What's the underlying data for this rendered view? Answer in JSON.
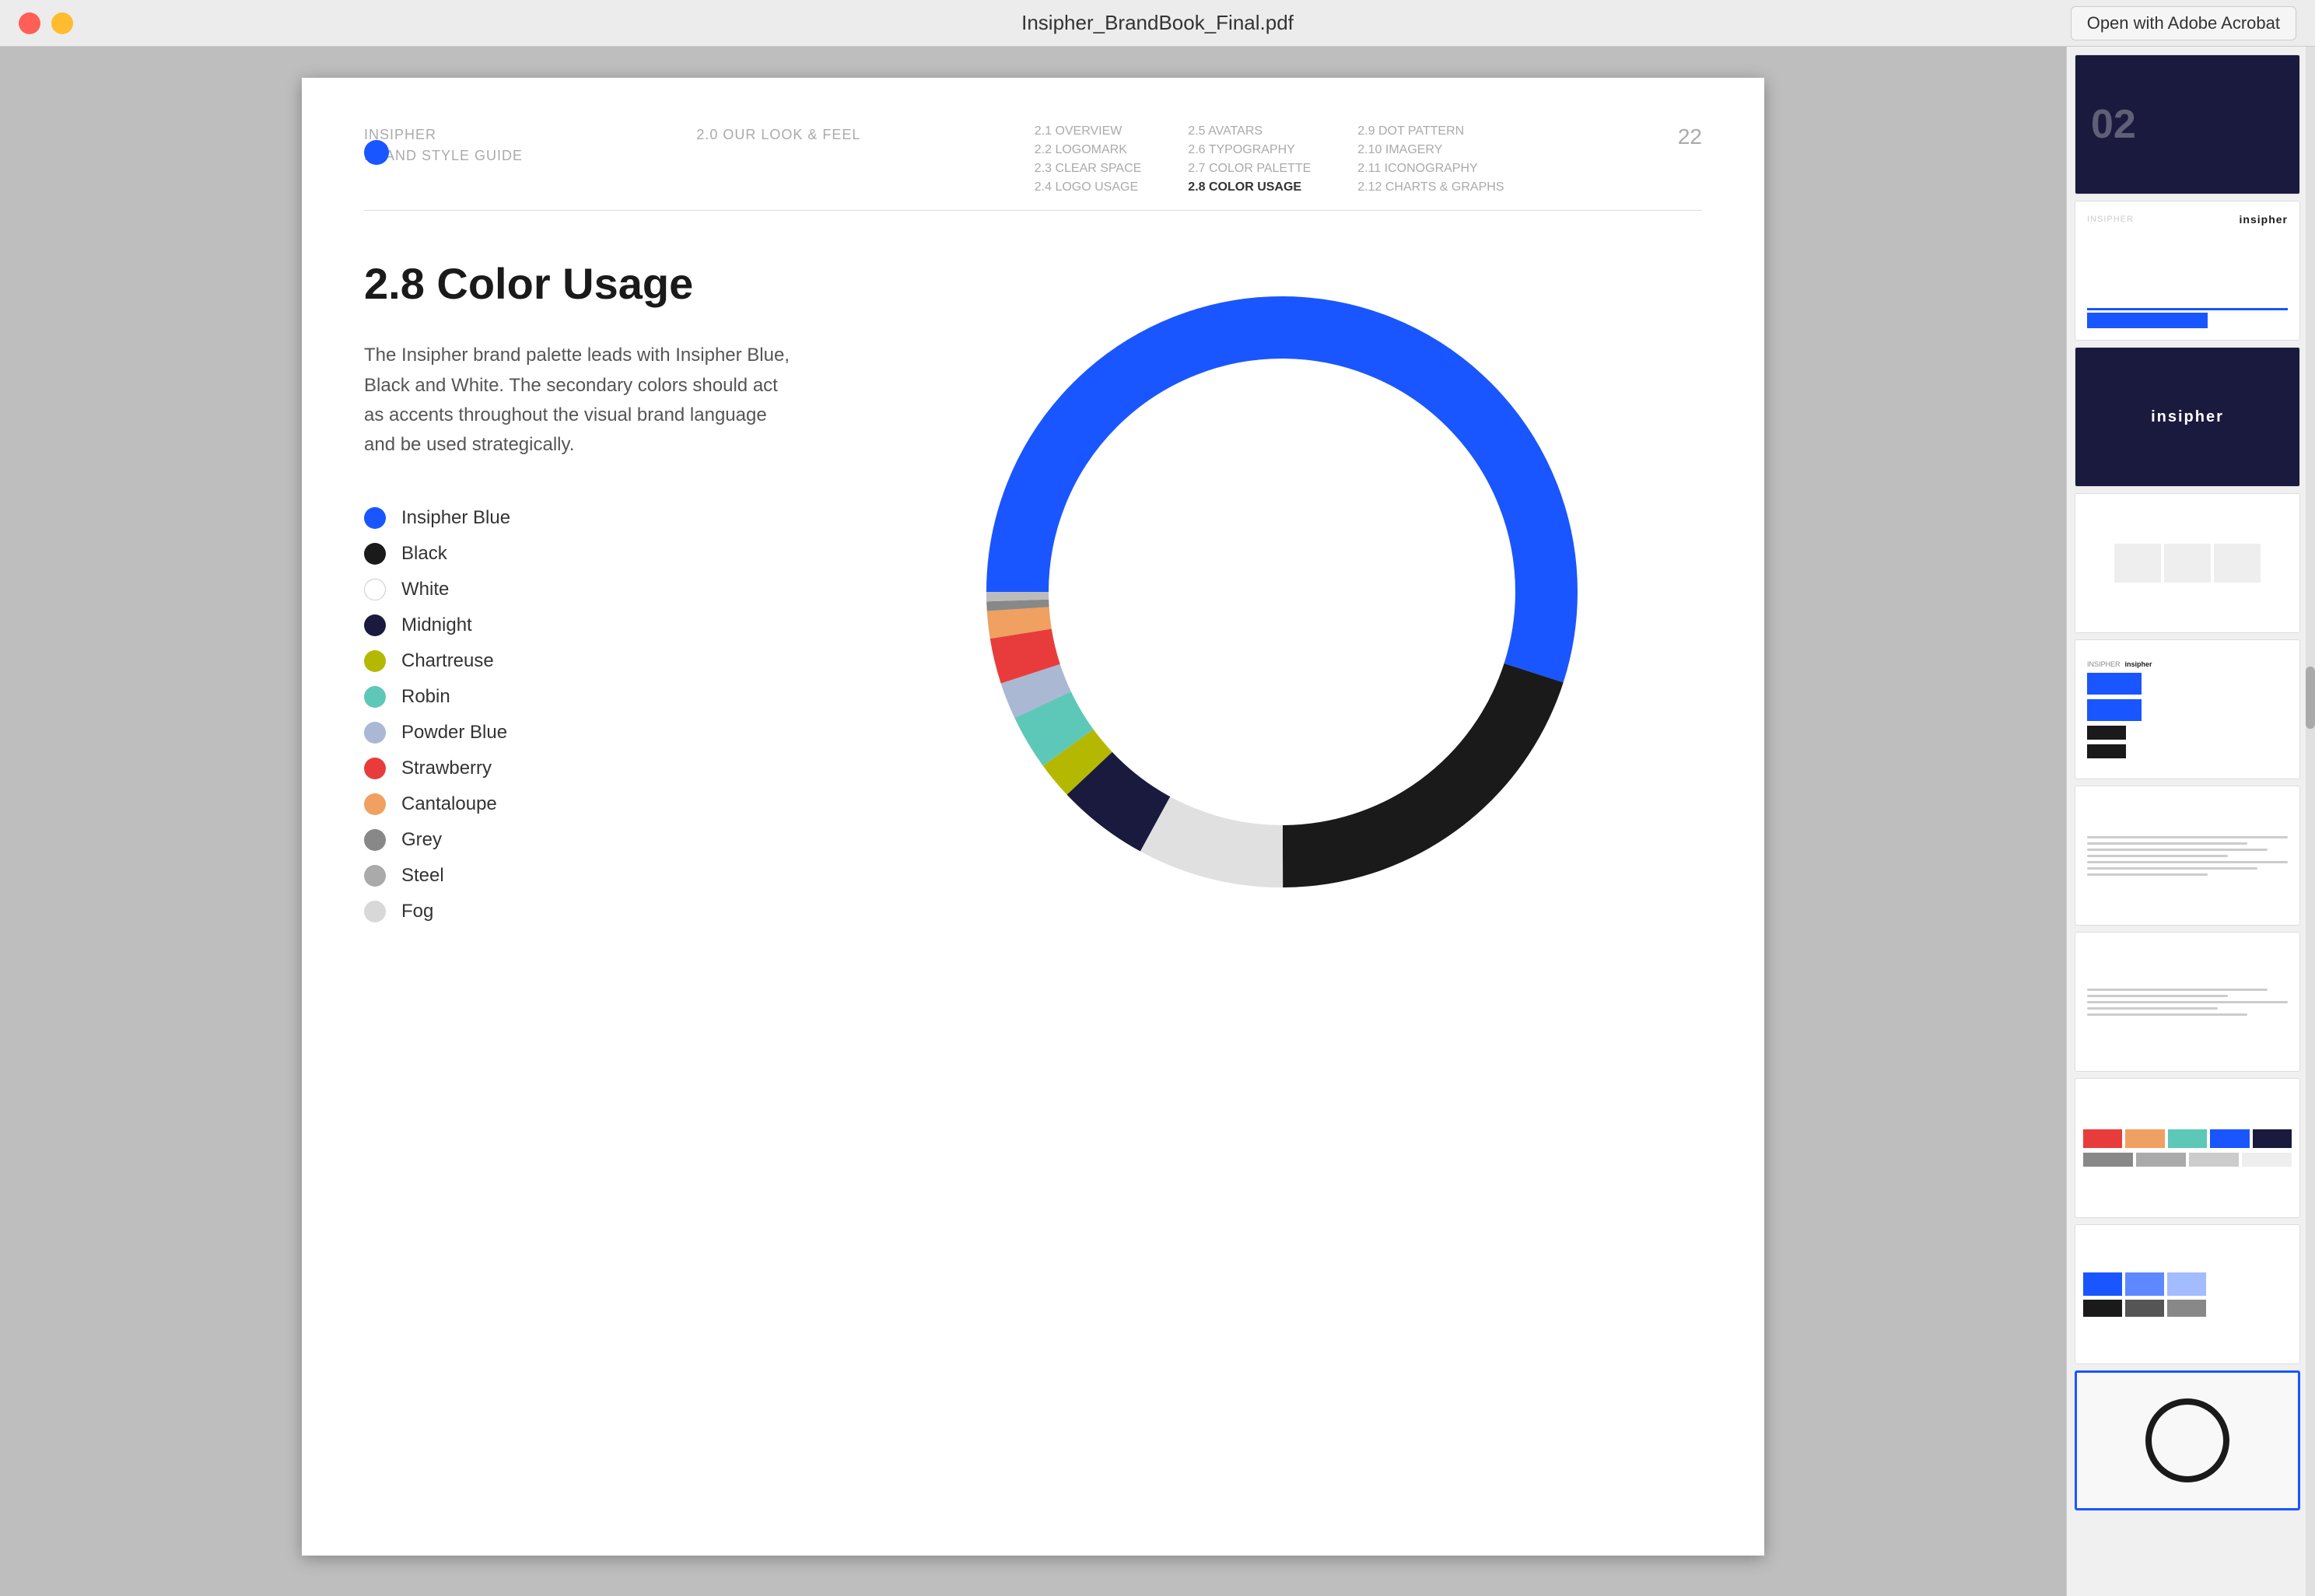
{
  "titlebar": {
    "title": "Insipher_BrandBook_Final.pdf",
    "open_acrobat_label": "Open with Adobe Acrobat"
  },
  "header": {
    "brand_line1": "INSIPHER",
    "brand_line2": "BRAND STYLE GUIDE",
    "section": "2.0  OUR LOOK & FEEL",
    "nav_col1": [
      "2.1  OVERVIEW",
      "2.2  LOGOMARK",
      "2.3  CLEAR SPACE",
      "2.4  LOGO USAGE"
    ],
    "nav_col2": [
      "2.5  AVATARS",
      "2.6  TYPOGRAPHY",
      "2.7  COLOR PALETTE",
      "2.8  COLOR USAGE"
    ],
    "nav_col3": [
      "2.9  DOT PATTERN",
      "2.10  IMAGERY",
      "2.11  ICONOGRAPHY",
      "2.12  CHARTS & GRAPHS"
    ],
    "page_number": "22"
  },
  "section": {
    "title": "2.8 Color Usage",
    "description": "The Insipher brand palette leads with Insipher Blue, Black and White. The secondary colors should act as accents throughout the visual brand language and be used strategically."
  },
  "legend": [
    {
      "id": "insipher-blue",
      "color": "#1a56ff",
      "label": "Insipher Blue",
      "border": false
    },
    {
      "id": "black",
      "color": "#1a1a1a",
      "label": "Black",
      "border": false
    },
    {
      "id": "white",
      "color": "#ffffff",
      "label": "White",
      "border": true
    },
    {
      "id": "midnight",
      "color": "#1a1a3e",
      "label": "Midnight",
      "border": false
    },
    {
      "id": "chartreuse",
      "color": "#b5b800",
      "label": "Chartreuse",
      "border": false
    },
    {
      "id": "robin",
      "color": "#5ec8b8",
      "label": "Robin",
      "border": false
    },
    {
      "id": "powder-blue",
      "color": "#aab8d4",
      "label": "Powder Blue",
      "border": false
    },
    {
      "id": "strawberry",
      "color": "#e83c3c",
      "label": "Strawberry",
      "border": false
    },
    {
      "id": "cantaloupe",
      "color": "#f0a060",
      "label": "Cantaloupe",
      "border": false
    },
    {
      "id": "grey",
      "color": "#888888",
      "label": "Grey",
      "border": false
    },
    {
      "id": "steel",
      "color": "#aaaaaa",
      "label": "Steel",
      "border": false
    },
    {
      "id": "fog",
      "color": "#d8d8d8",
      "label": "Fog",
      "border": false
    }
  ],
  "chart": {
    "segments": [
      {
        "color": "#1a56ff",
        "percentage": 55,
        "label": "Insipher Blue"
      },
      {
        "color": "#1a1a1a",
        "percentage": 20,
        "label": "Black"
      },
      {
        "color": "#dddddd",
        "percentage": 8,
        "label": "White"
      },
      {
        "color": "#1a1a3e",
        "percentage": 5,
        "label": "Midnight"
      },
      {
        "color": "#b5b800",
        "percentage": 2,
        "label": "Chartreuse"
      },
      {
        "color": "#5ec8b8",
        "percentage": 3,
        "label": "Robin"
      },
      {
        "color": "#aab8d4",
        "percentage": 2,
        "label": "Powder Blue"
      },
      {
        "color": "#e83c3c",
        "percentage": 2,
        "label": "Strawberry"
      },
      {
        "color": "#f0a060",
        "percentage": 1,
        "label": "Cantaloupe"
      },
      {
        "color": "#888888",
        "percentage": 1,
        "label": "Grey"
      },
      {
        "color": "#bbbbbb",
        "percentage": 1,
        "label": "Steel/Fog"
      }
    ]
  },
  "sidebar": {
    "thumbnails": [
      {
        "id": "thumb-1",
        "type": "dark-02"
      },
      {
        "id": "thumb-2",
        "type": "logo-white"
      },
      {
        "id": "thumb-3",
        "type": "logo-dark"
      },
      {
        "id": "thumb-4",
        "type": "lines"
      },
      {
        "id": "thumb-5",
        "type": "blue-blocks"
      },
      {
        "id": "thumb-6",
        "type": "text-lines"
      },
      {
        "id": "thumb-7",
        "type": "text-lines2"
      },
      {
        "id": "thumb-8",
        "type": "color-blocks"
      },
      {
        "id": "thumb-9",
        "type": "gray-blocks"
      },
      {
        "id": "thumb-10",
        "type": "circle",
        "active": true
      }
    ]
  }
}
